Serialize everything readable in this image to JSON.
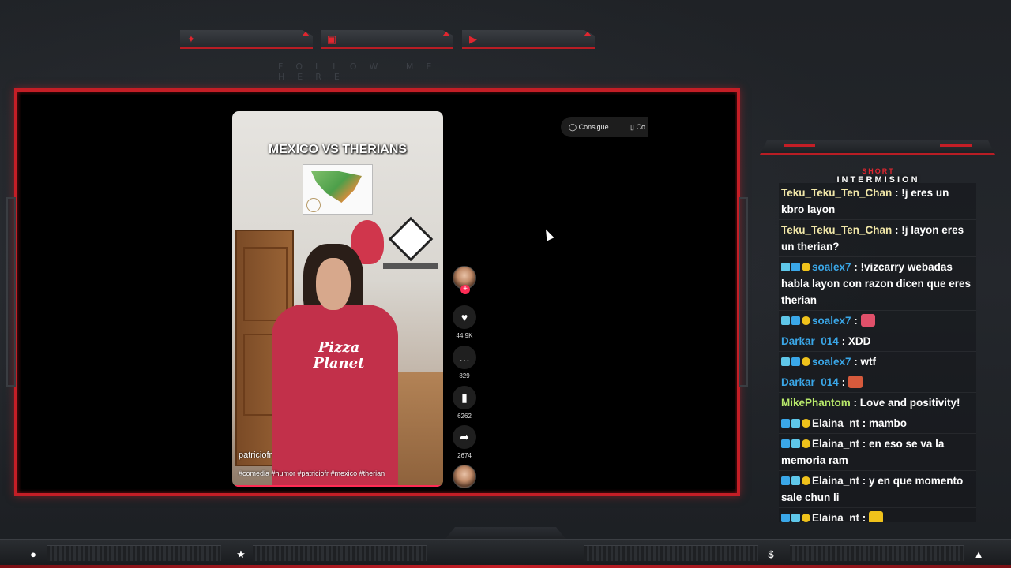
{
  "social": {
    "items": [
      {
        "name": "twitter",
        "icon": "twitter-icon"
      },
      {
        "name": "instagram",
        "icon": "instagram-icon"
      },
      {
        "name": "youtube",
        "icon": "youtube-icon"
      }
    ],
    "follow_text": "FOLLOW ME HERE"
  },
  "video": {
    "title": "MEXICO VS THERIANS",
    "username": "patriciofr",
    "hashtags": "#comedia #humor #patriciofr #mexico #therian",
    "shirt_text": "Pizza Planet"
  },
  "actions": {
    "likes": "44.9K",
    "comments": "829",
    "saves": "6262",
    "shares": "2674"
  },
  "pill": {
    "primary": "Consigue ...",
    "secondary": "Co"
  },
  "chat": {
    "title_small": "SHORT",
    "title": "INTERMISION",
    "messages": [
      {
        "user": "Teku_Teku_Ten_Chan",
        "color": "#f1e7a8",
        "text": "!j eres un kbro layon",
        "badges": []
      },
      {
        "user": "Teku_Teku_Ten_Chan",
        "color": "#f1e7a8",
        "text": "!j layon eres un therian?",
        "badges": []
      },
      {
        "user": "soalex7",
        "color": "#3aa7e8",
        "text": "!vizcarry webadas habla layon con razon dicen que eres therian",
        "badges": [
          "teal",
          "blue",
          "gold"
        ]
      },
      {
        "user": "soalex7",
        "color": "#3aa7e8",
        "text": "",
        "badges": [
          "teal",
          "blue",
          "gold"
        ],
        "emote": "#e0506a"
      },
      {
        "user": "Darkar_014",
        "color": "#3aa7e8",
        "text": "XDD",
        "badges": []
      },
      {
        "user": "soalex7",
        "color": "#3aa7e8",
        "text": "wtf",
        "badges": [
          "teal",
          "blue",
          "gold"
        ]
      },
      {
        "user": "Darkar_014",
        "color": "#3aa7e8",
        "text": "",
        "badges": [],
        "emote": "#d65a3c"
      },
      {
        "user": "MikePhantom",
        "color": "#b7e86a",
        "text": "Love and positivity!",
        "badges": []
      },
      {
        "user": "Elaina_nt",
        "color": "#f4f4f4",
        "text": "mambo",
        "badges": [
          "blue",
          "teal",
          "gold"
        ]
      },
      {
        "user": "Elaina_nt",
        "color": "#f4f4f4",
        "text": "en eso se va la memoria ram",
        "badges": [
          "blue",
          "teal",
          "gold"
        ]
      },
      {
        "user": "Elaina_nt",
        "color": "#f4f4f4",
        "text": "y en que momento sale chun li",
        "badges": [
          "blue",
          "teal",
          "gold"
        ]
      },
      {
        "user": "Elaina_nt",
        "color": "#f4f4f4",
        "text": "",
        "badges": [
          "blue",
          "teal",
          "gold"
        ],
        "emote": "#f0c21b"
      }
    ]
  },
  "bottom": {
    "icons": [
      "user-icon",
      "star-icon",
      "dollar-icon",
      "rocket-icon"
    ]
  },
  "colors": {
    "accent": "#c41e26",
    "background": "#23262b"
  }
}
